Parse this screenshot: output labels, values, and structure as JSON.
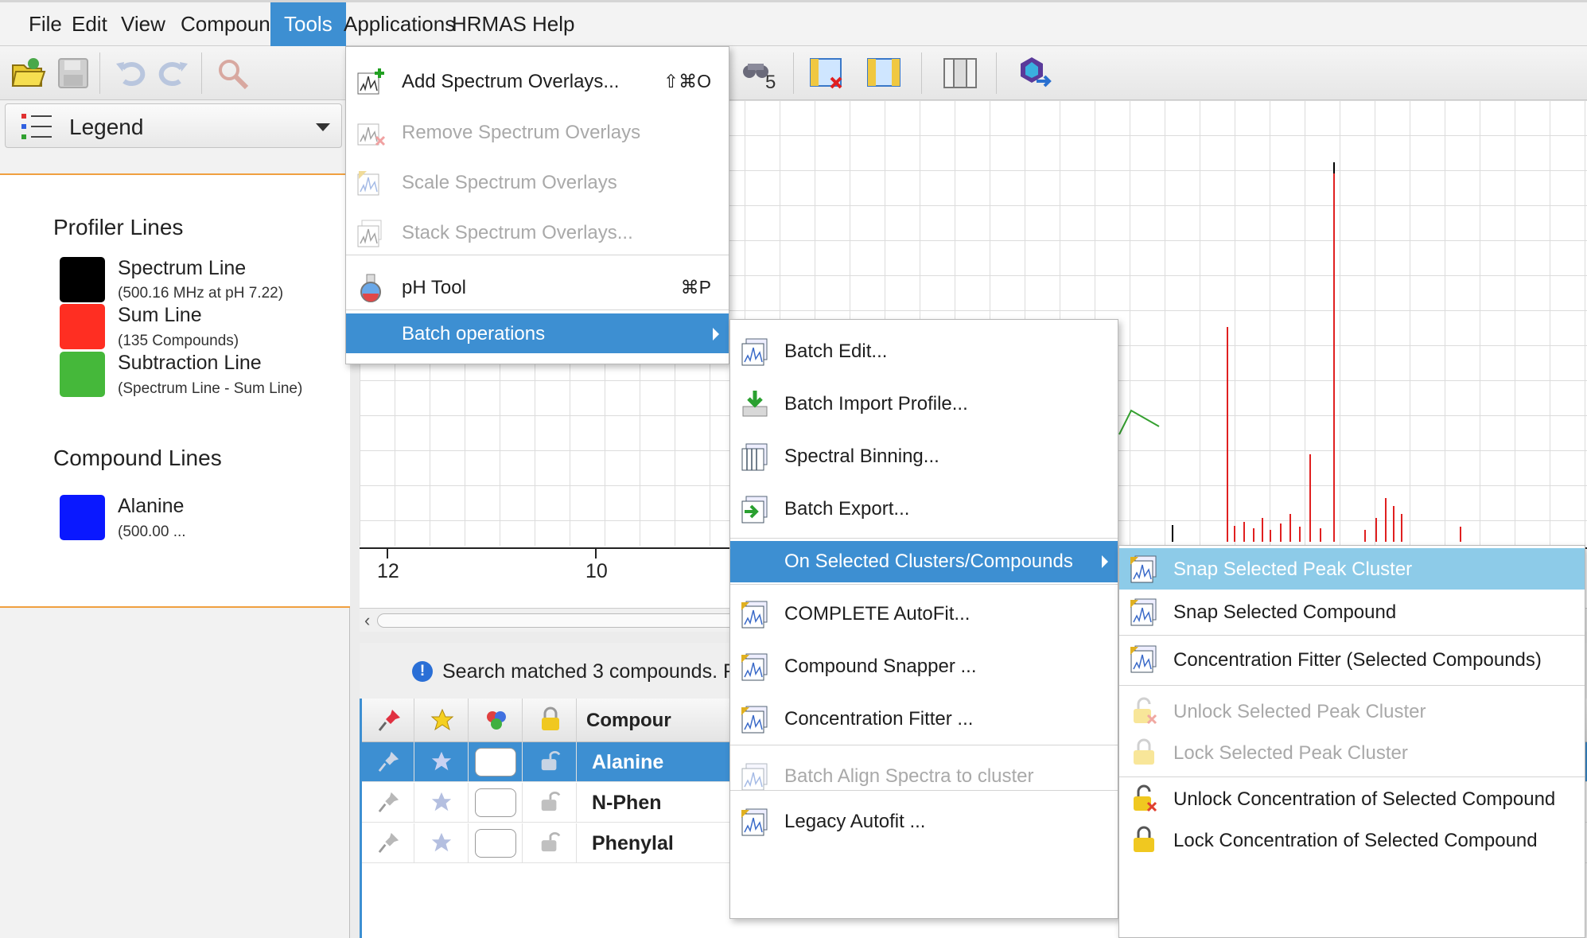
{
  "menubar": [
    "File",
    "Edit",
    "View",
    "Compound",
    "Tools",
    "Applications",
    "HRMAS",
    "Help"
  ],
  "legend": {
    "combo_label": "Legend",
    "profiler_title": "Profiler Lines",
    "compound_title": "Compound Lines",
    "items": [
      {
        "name": "Spectrum Line",
        "sub": "(500.16 MHz at pH 7.22)",
        "color": "#000000"
      },
      {
        "name": "Sum Line",
        "sub": "(135 Compounds)",
        "color": "#ff2e22"
      },
      {
        "name": "Subtraction Line",
        "sub": "(Spectrum Line  - Sum Line)",
        "color": "#45b83a"
      },
      {
        "name": "Alanine",
        "sub": "(500.00 ...",
        "color": "#0a18ff"
      }
    ]
  },
  "toolbar": {
    "badge": "5"
  },
  "axis": {
    "ticks": [
      "12",
      "10"
    ]
  },
  "search": {
    "message": "Search matched 3 compounds.  F"
  },
  "table": {
    "header_compound": "Compour",
    "rows": [
      "Alanine",
      "N-Phen",
      "Phenylal"
    ]
  },
  "tools_menu": {
    "items": [
      {
        "label": "Add Spectrum Overlays...",
        "accel": "⇧⌘O"
      },
      {
        "label": "Remove Spectrum Overlays"
      },
      {
        "label": "Scale Spectrum Overlays"
      },
      {
        "label": "Stack Spectrum Overlays..."
      },
      {
        "label": "pH Tool",
        "accel": "⌘P"
      },
      {
        "label": "Batch operations"
      }
    ]
  },
  "batch_menu": {
    "items": [
      {
        "label": "Batch Edit..."
      },
      {
        "label": "Batch Import Profile..."
      },
      {
        "label": "Spectral Binning..."
      },
      {
        "label": "Batch Export..."
      },
      {
        "label": "On Selected Clusters/Compounds"
      },
      {
        "label": "COMPLETE AutoFit..."
      },
      {
        "label": "Compound Snapper ..."
      },
      {
        "label": "Concentration Fitter ..."
      },
      {
        "label": "Batch Align Spectra to cluster"
      },
      {
        "label": "Legacy Autofit ..."
      }
    ]
  },
  "cluster_menu": {
    "items": [
      {
        "label": "Snap Selected Peak Cluster"
      },
      {
        "label": "Snap Selected Compound"
      },
      {
        "label": "Concentration Fitter (Selected Compounds)"
      },
      {
        "label": "Unlock Selected Peak Cluster"
      },
      {
        "label": "Lock Selected Peak Cluster"
      },
      {
        "label": "Unlock Concentration of Selected Compound"
      },
      {
        "label": "Lock Concentration of Selected Compound"
      }
    ]
  }
}
